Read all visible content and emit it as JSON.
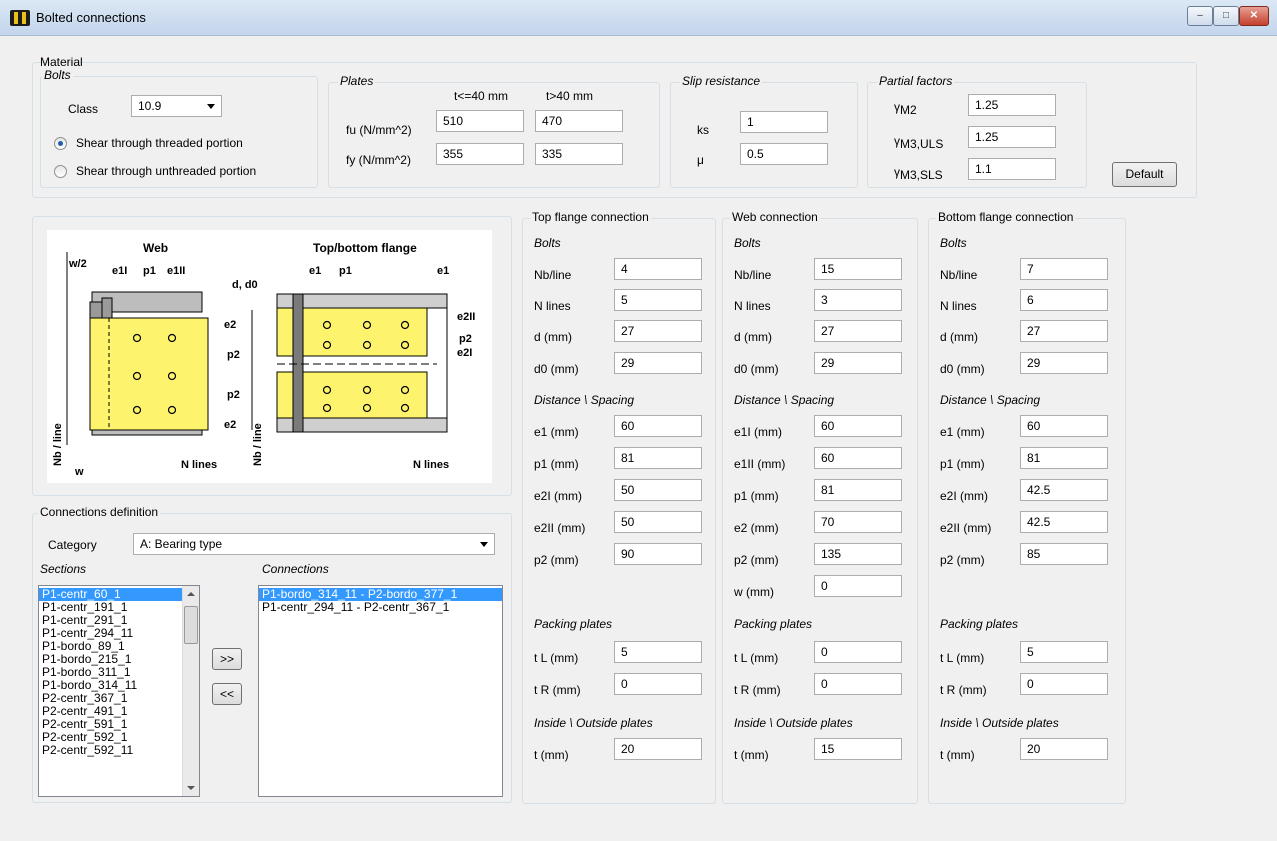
{
  "window": {
    "title": "Bolted connections",
    "min": "–",
    "max": "□",
    "close": "✕"
  },
  "material": {
    "title": "Material",
    "bolts": {
      "title": "Bolts",
      "class_label": "Class",
      "class_value": "10.9",
      "radio1": "Shear through threaded portion",
      "radio2": "Shear through unthreaded portion"
    },
    "plates": {
      "title": "Plates",
      "col1": "t<=40 mm",
      "col2": "t>40 mm",
      "fu_label": "fu (N/mm^2)",
      "fu1": "510",
      "fu2": "470",
      "fy_label": "fy (N/mm^2)",
      "fy1": "355",
      "fy2": "335"
    },
    "slip": {
      "title": "Slip resistance",
      "ks_label": "ks",
      "ks": "1",
      "mu_label": "μ",
      "mu": "0.5"
    },
    "partial": {
      "title": "Partial factors",
      "g_m2_sym": "γ",
      "g_m2_sub": "M2",
      "g_m2": "1.25",
      "g_m3uls_sym": "γ",
      "g_m3uls_sub": "M3,ULS",
      "g_m3uls": "1.25",
      "g_m3sls_sym": "γ",
      "g_m3sls_sub": "M3,SLS",
      "g_m3sls": "1.1"
    },
    "default_btn": "Default"
  },
  "diagram": {
    "web": "Web",
    "topbottom": "Top/bottom flange",
    "w2": "w/2",
    "e1I": "e1I",
    "p1": "p1",
    "e1II": "e1II",
    "d_d0": "d, d0",
    "e1": "e1",
    "e2": "e2",
    "e2II": "e2II",
    "e2I": "e2I",
    "p2": "p2",
    "nb_line": "Nb / line",
    "w": "w",
    "n_lines": "N lines"
  },
  "conndef": {
    "title": "Connections definition",
    "category_label": "Category",
    "category": "A: Bearing type",
    "sections_title": "Sections",
    "connections_title": "Connections",
    "add": ">>",
    "remove": "<<",
    "sections": [
      "P1-centr_60_1",
      "P1-centr_191_1",
      "P1-centr_291_1",
      "P1-centr_294_11",
      "P1-bordo_89_1",
      "P1-bordo_215_1",
      "P1-bordo_311_1",
      "P1-bordo_314_11",
      "P2-centr_367_1",
      "P2-centr_491_1",
      "P2-centr_591_1",
      "P2-centr_592_1",
      "P2-centr_592_11"
    ],
    "connections": [
      "P1-bordo_314_11 - P2-bordo_377_1",
      "P1-centr_294_11 - P2-centr_367_1"
    ]
  },
  "top": {
    "title": "Top flange connection",
    "bolts": "Bolts",
    "spacing": "Distance \\ Spacing",
    "packing": "Packing plates",
    "inout": "Inside \\ Outside plates",
    "nb_label": "Nb/line",
    "nb": "4",
    "nl_label": "N lines",
    "nl": "5",
    "d_label": "d (mm)",
    "d": "27",
    "d0_label": "d0 (mm)",
    "d0": "29",
    "s1_label": "e1 (mm)",
    "s1": "60",
    "s2_label": "p1 (mm)",
    "s2": "81",
    "s3_label": "e2I (mm)",
    "s3": "50",
    "s4_label": "e2II (mm)",
    "s4": "50",
    "s5_label": "p2 (mm)",
    "s5": "90",
    "tl_label": "t L (mm)",
    "tl": "5",
    "tr_label": "t R (mm)",
    "tr": "0",
    "t_label": "t (mm)",
    "t": "20"
  },
  "web": {
    "title": "Web connection",
    "bolts": "Bolts",
    "spacing": "Distance \\ Spacing",
    "packing": "Packing plates",
    "inout": "Inside \\ Outside plates",
    "nb_label": "Nb/line",
    "nb": "15",
    "nl_label": "N lines",
    "nl": "3",
    "d_label": "d (mm)",
    "d": "27",
    "d0_label": "d0 (mm)",
    "d0": "29",
    "s1_label": "e1I (mm)",
    "s1": "60",
    "s2_label": "e1II (mm)",
    "s2": "60",
    "s3_label": "p1 (mm)",
    "s3": "81",
    "s4_label": "e2 (mm)",
    "s4": "70",
    "s5_label": "p2 (mm)",
    "s5": "135",
    "s6_label": "w (mm)",
    "s6": "0",
    "tl_label": "t L (mm)",
    "tl": "0",
    "tr_label": "t R (mm)",
    "tr": "0",
    "t_label": "t (mm)",
    "t": "15"
  },
  "bottom": {
    "title": "Bottom flange connection",
    "bolts": "Bolts",
    "spacing": "Distance \\ Spacing",
    "packing": "Packing plates",
    "inout": "Inside \\ Outside plates",
    "nb_label": "Nb/line",
    "nb": "7",
    "nl_label": "N lines",
    "nl": "6",
    "d_label": "d (mm)",
    "d": "27",
    "d0_label": "d0 (mm)",
    "d0": "29",
    "s1_label": "e1 (mm)",
    "s1": "60",
    "s2_label": "p1 (mm)",
    "s2": "81",
    "s3_label": "e2I (mm)",
    "s3": "42.5",
    "s4_label": "e2II (mm)",
    "s4": "42.5",
    "s5_label": "p2 (mm)",
    "s5": "85",
    "tl_label": "t L (mm)",
    "tl": "5",
    "tr_label": "t R (mm)",
    "tr": "0",
    "t_label": "t (mm)",
    "t": "20"
  }
}
